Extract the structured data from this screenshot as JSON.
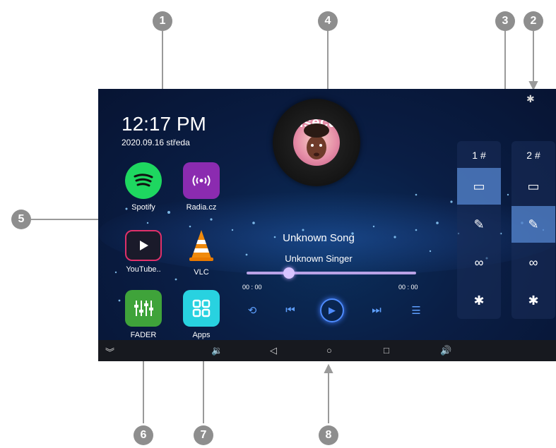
{
  "callouts": [
    "1",
    "2",
    "3",
    "4",
    "5",
    "6",
    "7",
    "8"
  ],
  "status": {
    "time": "12:17 PM",
    "date": "2020.09.16 středa",
    "bluetooth_icon": "bluetooth-icon"
  },
  "apps": [
    {
      "label": "Spotify",
      "icon": "spotify-icon"
    },
    {
      "label": "Radia.cz",
      "icon": "radio-icon"
    },
    {
      "label": "YouTube..",
      "icon": "youtube-icon"
    },
    {
      "label": "VLC",
      "icon": "vlc-icon"
    },
    {
      "label": "FADER",
      "icon": "fader-icon"
    },
    {
      "label": "Apps",
      "icon": "apps-icon"
    }
  ],
  "player": {
    "cover_text": "Insecure",
    "song": "Unknown Song",
    "singer": "Unknown Singer",
    "time_current": "00 : 00",
    "time_total": "00 : 00",
    "progress": 0.25,
    "controls": [
      "repeat-icon",
      "previous-icon",
      "play-icon",
      "next-icon",
      "playlist-icon"
    ]
  },
  "zones": [
    {
      "label": "1 #",
      "slots": [
        "display-icon",
        "mic-icon",
        "link-icon",
        "bluetooth-icon"
      ],
      "active_slot": 0
    },
    {
      "label": "2 #",
      "slots": [
        "display-icon",
        "mic-icon",
        "link-icon",
        "bluetooth-icon"
      ],
      "active_slot": 1
    }
  ],
  "navbar": [
    "collapse-icon",
    "volume-down-icon",
    "back-icon",
    "home-icon",
    "recents-icon",
    "volume-up-icon"
  ],
  "colors": {
    "background": "#0a1e45",
    "accent": "#4f8cff",
    "callout": "#8e8e8e"
  }
}
